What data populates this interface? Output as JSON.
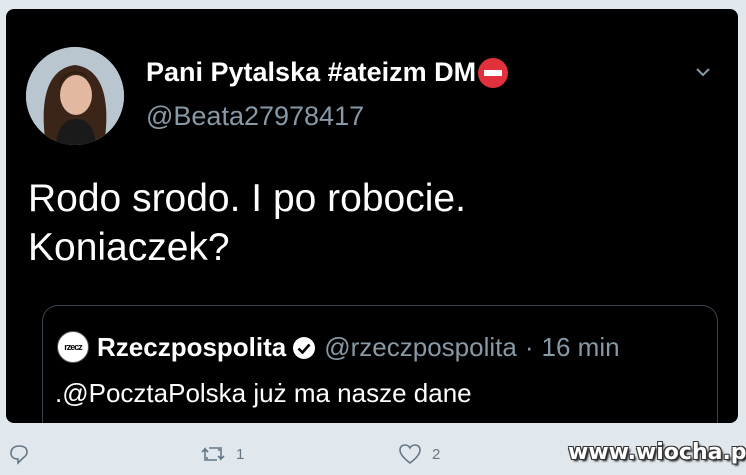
{
  "tweet": {
    "display_name": "Pani Pytalska #ateizm DM",
    "name_emoji": "no-entry-icon",
    "handle": "@Beata27978417",
    "text_lines": [
      "Rodo srodo. I po robocie.",
      "Koniaczek?"
    ],
    "menu_icon": "chevron-down-icon"
  },
  "quote": {
    "avatar_text": "rzecz",
    "name": "Rzeczpospolita",
    "verified_icon": "verified-badge-icon",
    "handle": "@rzeczpospolita",
    "separator": "·",
    "time": "16 min",
    "text": ".@PocztaPolska już ma nasze dane"
  },
  "actions": {
    "reply_icon": "reply-icon",
    "retweet_icon": "retweet-icon",
    "retweet_count": "1",
    "like_icon": "heart-icon",
    "like_count": "2"
  },
  "watermark": "www.wiocha.pl",
  "colors": {
    "card_bg": "#000000",
    "page_bg": "#e1e8ed",
    "muted_text": "#8899a6",
    "action_icon": "#657786",
    "verified": "#ffffff",
    "no_entry": "#e0313d"
  }
}
